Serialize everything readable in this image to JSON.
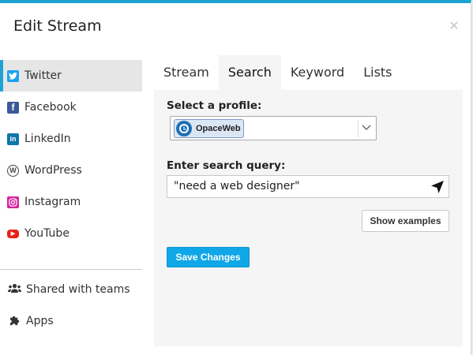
{
  "modal": {
    "title": "Edit Stream",
    "close_icon": "close-icon"
  },
  "sidebar": {
    "networks": [
      {
        "label": "Twitter",
        "icon": "twitter-icon",
        "active": true
      },
      {
        "label": "Facebook",
        "icon": "facebook-icon"
      },
      {
        "label": "LinkedIn",
        "icon": "linkedin-icon"
      },
      {
        "label": "WordPress",
        "icon": "wordpress-icon"
      },
      {
        "label": "Instagram",
        "icon": "instagram-icon"
      },
      {
        "label": "YouTube",
        "icon": "youtube-icon"
      }
    ],
    "extras": [
      {
        "label": "Shared with teams",
        "icon": "team-icon"
      },
      {
        "label": "Apps",
        "icon": "puzzle-icon"
      }
    ]
  },
  "tabs": [
    {
      "label": "Stream"
    },
    {
      "label": "Search",
      "active": true
    },
    {
      "label": "Keyword"
    },
    {
      "label": "Lists"
    }
  ],
  "form": {
    "profile_label": "Select a profile:",
    "selected_profile": "OpaceWeb",
    "query_label": "Enter search query:",
    "query_value": "\"need a web designer\"",
    "show_examples": "Show examples",
    "save": "Save Changes"
  },
  "colors": {
    "accent": "#1fa3d5",
    "save_button": "#10a7e8",
    "panel_bg": "#f5f5f5"
  }
}
